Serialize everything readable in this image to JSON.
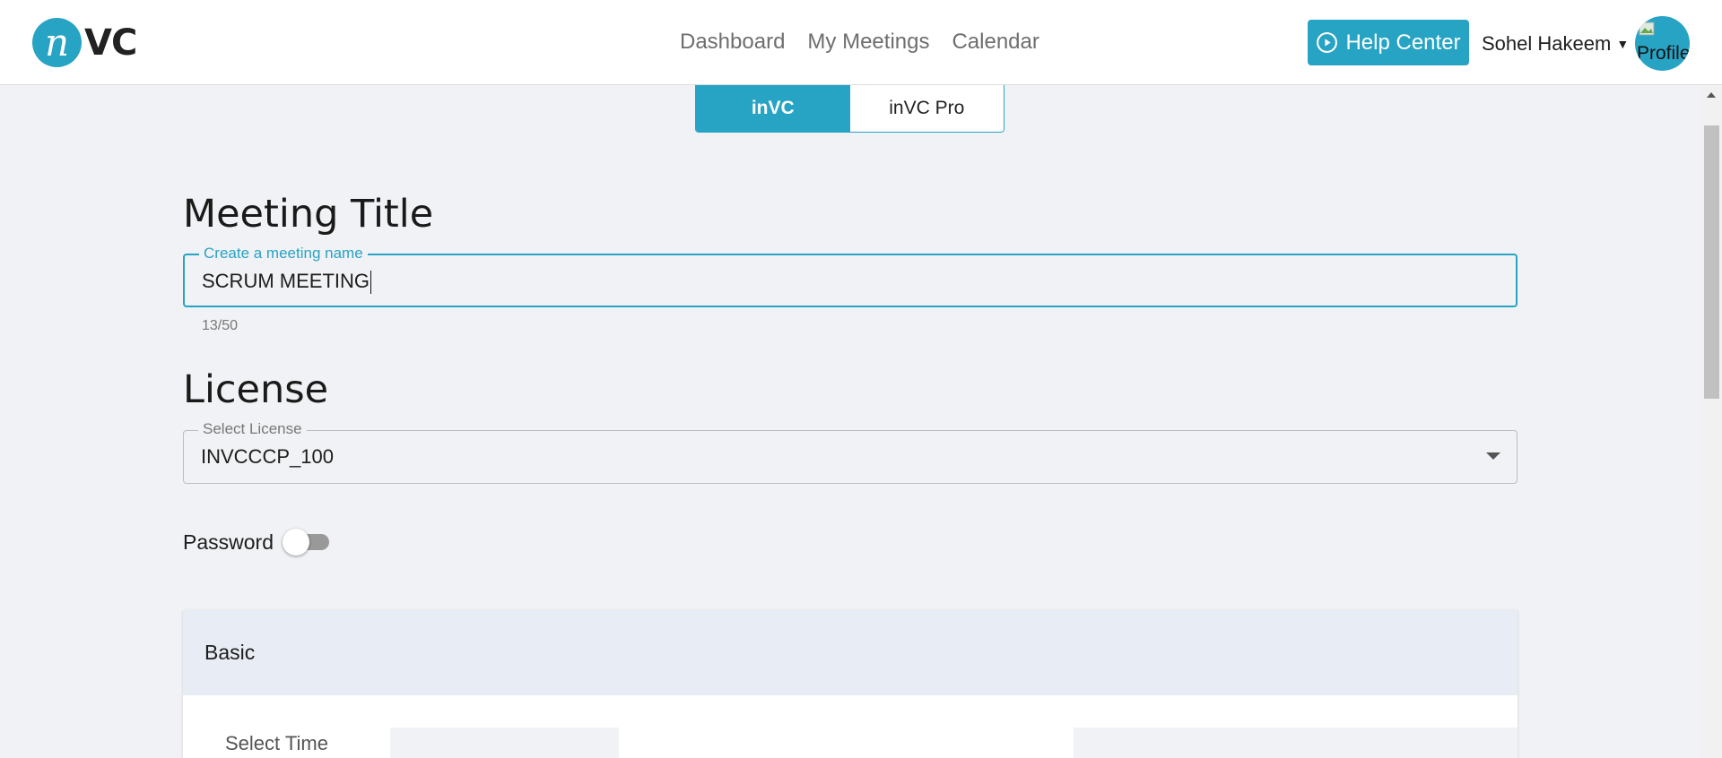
{
  "app": {
    "logo_letter": "n",
    "logo_text": "VC"
  },
  "nav": {
    "items": [
      "Dashboard",
      "My Meetings",
      "Calendar"
    ]
  },
  "header": {
    "help_label": "Help Center",
    "user_name": "Sohel Hakeem",
    "avatar_alt": "Profile"
  },
  "tabs": [
    {
      "label": "inVC",
      "active": true
    },
    {
      "label": "inVC Pro",
      "active": false
    }
  ],
  "meeting_title": {
    "heading": "Meeting Title",
    "field_label": "Create a meeting name",
    "value": "SCRUM MEETING",
    "counter": "13/50"
  },
  "license": {
    "heading": "License",
    "field_label": "Select License",
    "value": "INVCCCP_100"
  },
  "password": {
    "label": "Password",
    "enabled": false
  },
  "basic": {
    "header": "Basic",
    "select_time_label": "Select Time"
  },
  "colors": {
    "accent": "#27a3c4",
    "background": "#f1f2f5",
    "panel_header": "#e8ecf4"
  }
}
